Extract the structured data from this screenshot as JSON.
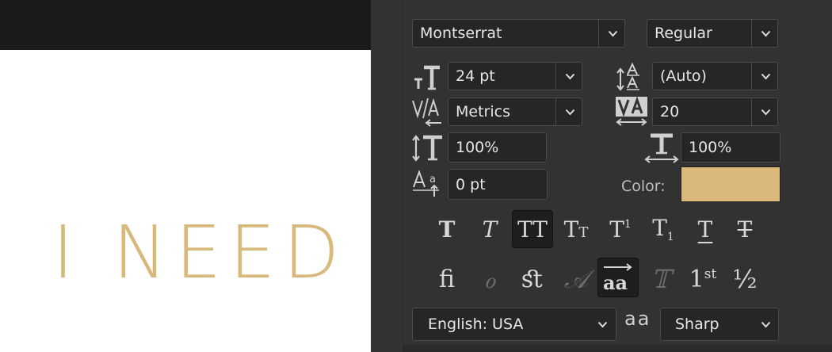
{
  "canvas": {
    "text": "I NEED",
    "text_color": "#d8b97c"
  },
  "character_panel": {
    "font_family": {
      "value": "Montserrat"
    },
    "font_style": {
      "value": "Regular"
    },
    "font_size": {
      "value": "24 pt"
    },
    "leading": {
      "value": "(Auto)"
    },
    "kerning": {
      "value": "Metrics"
    },
    "tracking": {
      "value": "20"
    },
    "vertical_scale": {
      "value": "100%"
    },
    "horizontal_scale": {
      "value": "100%"
    },
    "baseline_shift": {
      "value": "0 pt"
    },
    "color": {
      "label": "Color:",
      "swatch": "#dbb87c"
    },
    "style_buttons": [
      {
        "name": "faux-bold",
        "glyph": "T",
        "active": false
      },
      {
        "name": "faux-italic",
        "glyph": "T",
        "active": false
      },
      {
        "name": "all-caps",
        "glyph": "TT",
        "active": true
      },
      {
        "name": "small-caps",
        "glyph": "Tт",
        "active": false
      },
      {
        "name": "superscript",
        "glyph": "T¹",
        "active": false
      },
      {
        "name": "subscript",
        "glyph": "T₁",
        "active": false
      },
      {
        "name": "underline",
        "glyph": "T",
        "active": false
      },
      {
        "name": "strikethrough",
        "glyph": "T",
        "active": false
      }
    ],
    "opentype_buttons": [
      {
        "name": "standard-ligatures",
        "glyph": "ﬁ",
        "active": false,
        "enabled": true
      },
      {
        "name": "contextual-alternates",
        "glyph": "ℴ",
        "active": false,
        "enabled": false
      },
      {
        "name": "discretionary-ligatures",
        "glyph": "ﬆ",
        "active": false,
        "enabled": true
      },
      {
        "name": "swash",
        "glyph": "𝒜",
        "active": false,
        "enabled": false
      },
      {
        "name": "stylistic-alternates",
        "glyph": "aa",
        "active": true,
        "enabled": true
      },
      {
        "name": "titling-alternates",
        "glyph": "𝕋",
        "active": false,
        "enabled": false
      },
      {
        "name": "ordinals",
        "glyph": "1st",
        "active": false,
        "enabled": true
      },
      {
        "name": "fractions",
        "glyph": "½",
        "active": false,
        "enabled": true
      }
    ],
    "language": {
      "value": "English: USA"
    },
    "antialias_icon_text": "aa",
    "antialias": {
      "value": "Sharp"
    }
  }
}
